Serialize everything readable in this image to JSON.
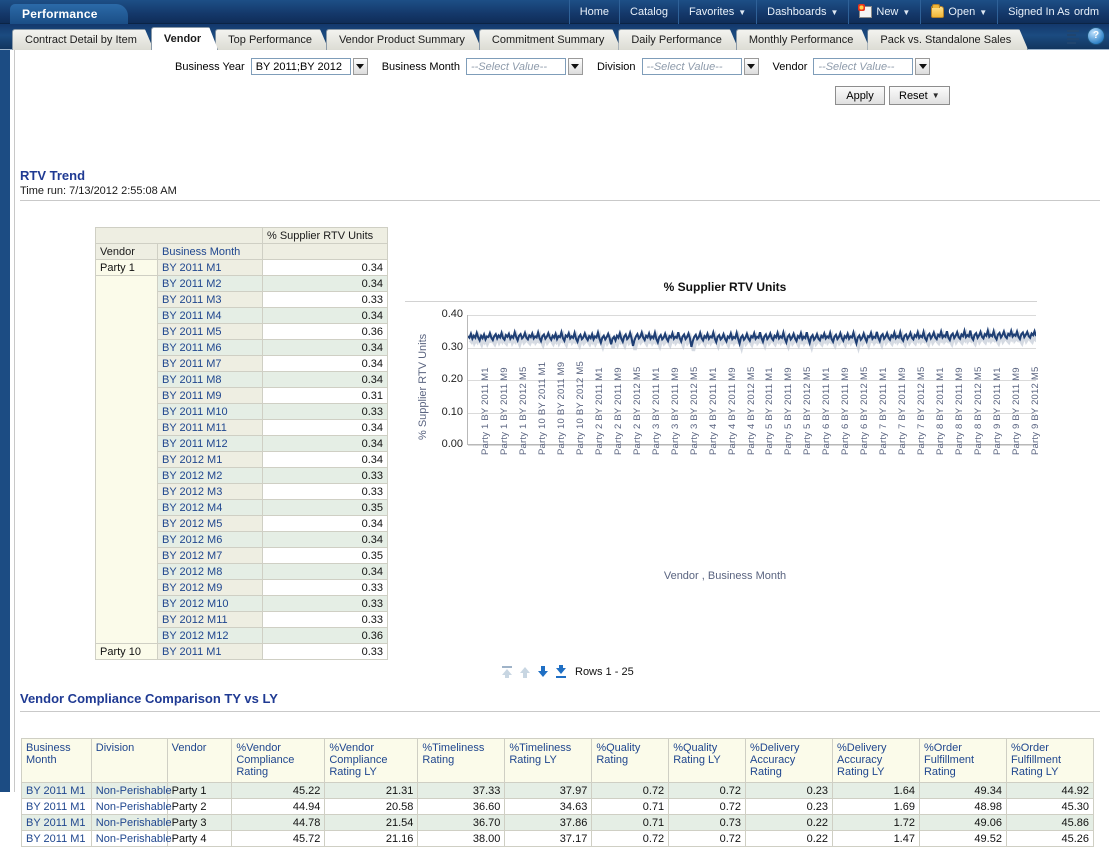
{
  "header": {
    "app_tab": "Performance",
    "nav": [
      {
        "label": "Home",
        "icon": null,
        "caret": false
      },
      {
        "label": "Catalog",
        "icon": null,
        "caret": false
      },
      {
        "label": "Favorites",
        "icon": null,
        "caret": true
      },
      {
        "label": "Dashboards",
        "icon": null,
        "caret": true
      },
      {
        "label": "New",
        "icon": "new-page-icon",
        "caret": true
      },
      {
        "label": "Open",
        "icon": "open-folder-icon",
        "caret": true
      }
    ],
    "signed_in_label": "Signed In As",
    "signed_in_user": "ordm"
  },
  "tabs": [
    {
      "label": "Contract Detail by Item",
      "active": false
    },
    {
      "label": "Vendor",
      "active": true
    },
    {
      "label": "Top Performance",
      "active": false
    },
    {
      "label": "Vendor Product Summary",
      "active": false
    },
    {
      "label": "Commitment Summary",
      "active": false
    },
    {
      "label": "Daily Performance",
      "active": false
    },
    {
      "label": "Monthly Performance",
      "active": false
    },
    {
      "label": "Pack vs. Standalone Sales",
      "active": false
    }
  ],
  "tab_tools": {
    "page_options_icon": "page-options-icon",
    "help_icon": "help-icon",
    "help_glyph": "?"
  },
  "prompts": {
    "business_year": {
      "label": "Business Year",
      "value": "BY 2011;BY 2012",
      "is_placeholder": false
    },
    "business_month": {
      "label": "Business Month",
      "value": "--Select Value--",
      "is_placeholder": true
    },
    "division": {
      "label": "Division",
      "value": "--Select Value--",
      "is_placeholder": true
    },
    "vendor": {
      "label": "Vendor",
      "value": "--Select Value--",
      "is_placeholder": true
    },
    "apply_label": "Apply",
    "reset_label": "Reset"
  },
  "rtv_section": {
    "title": "RTV Trend",
    "time_run": "Time run: 7/13/2012 2:55:08 AM",
    "table": {
      "measure_header": "% Supplier RTV Units",
      "col_vendor": "Vendor",
      "col_month": "Business Month",
      "rows": [
        {
          "vendor": "Party 1",
          "month": "BY 2011 M1",
          "value": "0.34"
        },
        {
          "vendor": "",
          "month": "BY 2011 M2",
          "value": "0.34"
        },
        {
          "vendor": "",
          "month": "BY 2011 M3",
          "value": "0.33"
        },
        {
          "vendor": "",
          "month": "BY 2011 M4",
          "value": "0.34"
        },
        {
          "vendor": "",
          "month": "BY 2011 M5",
          "value": "0.36"
        },
        {
          "vendor": "",
          "month": "BY 2011 M6",
          "value": "0.34"
        },
        {
          "vendor": "",
          "month": "BY 2011 M7",
          "value": "0.34"
        },
        {
          "vendor": "",
          "month": "BY 2011 M8",
          "value": "0.34"
        },
        {
          "vendor": "",
          "month": "BY 2011 M9",
          "value": "0.31"
        },
        {
          "vendor": "",
          "month": "BY 2011 M10",
          "value": "0.33"
        },
        {
          "vendor": "",
          "month": "BY 2011 M11",
          "value": "0.34"
        },
        {
          "vendor": "",
          "month": "BY 2011 M12",
          "value": "0.34"
        },
        {
          "vendor": "",
          "month": "BY 2012 M1",
          "value": "0.34"
        },
        {
          "vendor": "",
          "month": "BY 2012 M2",
          "value": "0.33"
        },
        {
          "vendor": "",
          "month": "BY 2012 M3",
          "value": "0.33"
        },
        {
          "vendor": "",
          "month": "BY 2012 M4",
          "value": "0.35"
        },
        {
          "vendor": "",
          "month": "BY 2012 M5",
          "value": "0.34"
        },
        {
          "vendor": "",
          "month": "BY 2012 M6",
          "value": "0.34"
        },
        {
          "vendor": "",
          "month": "BY 2012 M7",
          "value": "0.35"
        },
        {
          "vendor": "",
          "month": "BY 2012 M8",
          "value": "0.34"
        },
        {
          "vendor": "",
          "month": "BY 2012 M9",
          "value": "0.33"
        },
        {
          "vendor": "",
          "month": "BY 2012 M10",
          "value": "0.33"
        },
        {
          "vendor": "",
          "month": "BY 2012 M11",
          "value": "0.33"
        },
        {
          "vendor": "",
          "month": "BY 2012 M12",
          "value": "0.36"
        },
        {
          "vendor": "Party 10",
          "month": "BY 2011 M1",
          "value": "0.33"
        }
      ]
    },
    "paging": {
      "first_label": "first-page",
      "prev_label": "previous-page",
      "next_label": "next-page",
      "last_label": "last-page",
      "rows_text": "Rows 1 - 25"
    }
  },
  "chart_data": {
    "type": "line",
    "title": "% Supplier RTV Units",
    "xlabel": "Vendor , Business Month",
    "ylabel": "% Supplier RTV Units",
    "ylim": [
      0.0,
      0.4
    ],
    "yticks": [
      "0.00",
      "0.10",
      "0.20",
      "0.30",
      "0.40"
    ],
    "grid": true,
    "legend": "none",
    "series_name": "% Supplier RTV Units",
    "line_color": "#1f3f74",
    "xticks": [
      "Party 1 BY 2011 M1",
      "Party 1 BY 2011 M9",
      "Party 1 BY 2012 M5",
      "Party 10 BY 2011 M1",
      "Party 10 BY 2011 M9",
      "Party 10 BY 2012 M5",
      "Party 2 BY 2011 M1",
      "Party 2 BY 2011 M9",
      "Party 2 BY 2012 M5",
      "Party 3 BY 2011 M1",
      "Party 3 BY 2011 M9",
      "Party 3 BY 2012 M5",
      "Party 4 BY 2011 M1",
      "Party 4 BY 2011 M9",
      "Party 4 BY 2012 M5",
      "Party 5 BY 2011 M1",
      "Party 5 BY 2011 M9",
      "Party 5 BY 2012 M5",
      "Party 6 BY 2011 M1",
      "Party 6 BY 2011 M9",
      "Party 6 BY 2012 M5",
      "Party 7 BY 2011 M1",
      "Party 7 BY 2011 M9",
      "Party 7 BY 2012 M5",
      "Party 8 BY 2011 M1",
      "Party 8 BY 2011 M9",
      "Party 8 BY 2012 M5",
      "Party 9 BY 2011 M1",
      "Party 9 BY 2011 M9",
      "Party 9 BY 2012 M5"
    ],
    "values": [
      0.335,
      0.33,
      0.342,
      0.327,
      0.336,
      0.33,
      0.345,
      0.331,
      0.322,
      0.336,
      0.329,
      0.34,
      0.325,
      0.334,
      0.332,
      0.344,
      0.33,
      0.323,
      0.335,
      0.341,
      0.328,
      0.337,
      0.331,
      0.345,
      0.329,
      0.324,
      0.338,
      0.333,
      0.342,
      0.327,
      0.335,
      0.33,
      0.347,
      0.332,
      0.322,
      0.336,
      0.341,
      0.328,
      0.333,
      0.345,
      0.33,
      0.325,
      0.337,
      0.332,
      0.343,
      0.328,
      0.334,
      0.331,
      0.346,
      0.329,
      0.32,
      0.335,
      0.34,
      0.327,
      0.333,
      0.344,
      0.331,
      0.324,
      0.336,
      0.33,
      0.342,
      0.326,
      0.335,
      0.332,
      0.347,
      0.329,
      0.321,
      0.337,
      0.333,
      0.344,
      0.328,
      0.334,
      0.33,
      0.345,
      0.327,
      0.318,
      0.333,
      0.339,
      0.326,
      0.331,
      0.343,
      0.33,
      0.323,
      0.335,
      0.329,
      0.341,
      0.325,
      0.334,
      0.331,
      0.346,
      0.328,
      0.315,
      0.33,
      0.336,
      0.325,
      0.332,
      0.342,
      0.329,
      0.31,
      0.327,
      0.333,
      0.322,
      0.336,
      0.33,
      0.344,
      0.327,
      0.318,
      0.334,
      0.34,
      0.326,
      0.331,
      0.345,
      0.329,
      0.305,
      0.322,
      0.334,
      0.341,
      0.328,
      0.333,
      0.346,
      0.33,
      0.323,
      0.336,
      0.331,
      0.343,
      0.327,
      0.334,
      0.329,
      0.345,
      0.326,
      0.316,
      0.332,
      0.338,
      0.325,
      0.33,
      0.342,
      0.328,
      0.32,
      0.335,
      0.331,
      0.344,
      0.327,
      0.333,
      0.33,
      0.347,
      0.329,
      0.319,
      0.334,
      0.34,
      0.326,
      0.332,
      0.343,
      0.328,
      0.302,
      0.32,
      0.333,
      0.339,
      0.326,
      0.331,
      0.345,
      0.329,
      0.322,
      0.335,
      0.33,
      0.342,
      0.327,
      0.334,
      0.331,
      0.346,
      0.328,
      0.317,
      0.333,
      0.338,
      0.325,
      0.33,
      0.341,
      0.327,
      0.319,
      0.334,
      0.33,
      0.343,
      0.326,
      0.332,
      0.329,
      0.345,
      0.327,
      0.312,
      0.331,
      0.337,
      0.324,
      0.33,
      0.342,
      0.328,
      0.321,
      0.335,
      0.331,
      0.344,
      0.327,
      0.333,
      0.33,
      0.347,
      0.329,
      0.318,
      0.334,
      0.34,
      0.326,
      0.332,
      0.343,
      0.329,
      0.323,
      0.336,
      0.331,
      0.345,
      0.328,
      0.334,
      0.33,
      0.346,
      0.327,
      0.316,
      0.333,
      0.339,
      0.325,
      0.331,
      0.342,
      0.328,
      0.32,
      0.335,
      0.33,
      0.344,
      0.326,
      0.333,
      0.329,
      0.347,
      0.328,
      0.314,
      0.332,
      0.338,
      0.324,
      0.33,
      0.341,
      0.327,
      0.322,
      0.336,
      0.331,
      0.343,
      0.328,
      0.334,
      0.33,
      0.345,
      0.326,
      0.318,
      0.333,
      0.339,
      0.326,
      0.332,
      0.344,
      0.329,
      0.321,
      0.335,
      0.33,
      0.342,
      0.327,
      0.334,
      0.331,
      0.346,
      0.328,
      0.313,
      0.331,
      0.337,
      0.324,
      0.33,
      0.343,
      0.329,
      0.319,
      0.335,
      0.332,
      0.345,
      0.327,
      0.333,
      0.33,
      0.348,
      0.33,
      0.32,
      0.336,
      0.341,
      0.327,
      0.333,
      0.344,
      0.33,
      0.324,
      0.337,
      0.332,
      0.346,
      0.329,
      0.335,
      0.331,
      0.347,
      0.328,
      0.321,
      0.336,
      0.34,
      0.327,
      0.334,
      0.345,
      0.33,
      0.325,
      0.338,
      0.333,
      0.347,
      0.33,
      0.336,
      0.332,
      0.348,
      0.329,
      0.322,
      0.337,
      0.342,
      0.328,
      0.335,
      0.346,
      0.331,
      0.326,
      0.339,
      0.334,
      0.349,
      0.331,
      0.337,
      0.333,
      0.35,
      0.33,
      0.323,
      0.338,
      0.343,
      0.329,
      0.336,
      0.347,
      0.332,
      0.327,
      0.34,
      0.335,
      0.351,
      0.332,
      0.338,
      0.334,
      0.352,
      0.331,
      0.324,
      0.339,
      0.344,
      0.33,
      0.337,
      0.348,
      0.333,
      0.328,
      0.341,
      0.336,
      0.352,
      0.333,
      0.339,
      0.335,
      0.35,
      0.332,
      0.325,
      0.34,
      0.345,
      0.331,
      0.338,
      0.349,
      0.334,
      0.329,
      0.342,
      0.337,
      0.351,
      0.334,
      0.34,
      0.336,
      0.349,
      0.333,
      0.326,
      0.341,
      0.346,
      0.332,
      0.339,
      0.348,
      0.335,
      0.33,
      0.343,
      0.338,
      0.35,
      0.335
    ]
  },
  "compliance_section": {
    "title": "Vendor Compliance Comparison TY vs LY",
    "columns": [
      "Business Month",
      "Division",
      "Vendor",
      "%Vendor Compliance Rating",
      "%Vendor Compliance Rating LY",
      "%Timeliness Rating",
      "%Timeliness Rating LY",
      "%Quality Rating",
      "%Quality Rating LY",
      "%Delivery Accuracy Rating",
      "%Delivery Accuracy Rating LY",
      "%Order Fulfillment Rating",
      "%Order Fulfillment Rating LY"
    ],
    "rows": [
      [
        "BY 2011 M1",
        "Non-Perishable",
        "Party 1",
        "45.22",
        "21.31",
        "37.33",
        "37.97",
        "0.72",
        "0.72",
        "0.23",
        "1.64",
        "49.34",
        "44.92"
      ],
      [
        "BY 2011 M1",
        "Non-Perishable",
        "Party 2",
        "44.94",
        "20.58",
        "36.60",
        "34.63",
        "0.71",
        "0.72",
        "0.23",
        "1.69",
        "48.98",
        "45.30"
      ],
      [
        "BY 2011 M1",
        "Non-Perishable",
        "Party 3",
        "44.78",
        "21.54",
        "36.70",
        "37.86",
        "0.71",
        "0.73",
        "0.22",
        "1.72",
        "49.06",
        "45.86"
      ],
      [
        "BY 2011 M1",
        "Non-Perishable",
        "Party 4",
        "45.72",
        "21.16",
        "38.00",
        "37.17",
        "0.72",
        "0.72",
        "0.22",
        "1.47",
        "49.52",
        "45.26"
      ]
    ]
  }
}
